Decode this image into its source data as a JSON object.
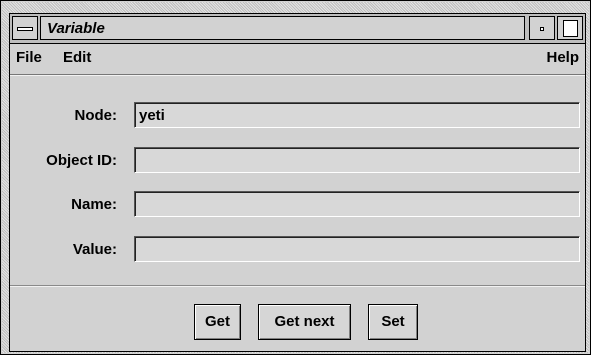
{
  "window": {
    "title": "Variable"
  },
  "menubar": {
    "file": "File",
    "edit": "Edit",
    "help": "Help"
  },
  "form": {
    "node": {
      "label": "Node:",
      "value": "yeti"
    },
    "object_id": {
      "label": "Object ID:",
      "value": ""
    },
    "name": {
      "label": "Name:",
      "value": ""
    },
    "value": {
      "label": "Value:",
      "value": ""
    }
  },
  "buttons": {
    "get": "Get",
    "get_next": "Get next",
    "set": "Set"
  }
}
